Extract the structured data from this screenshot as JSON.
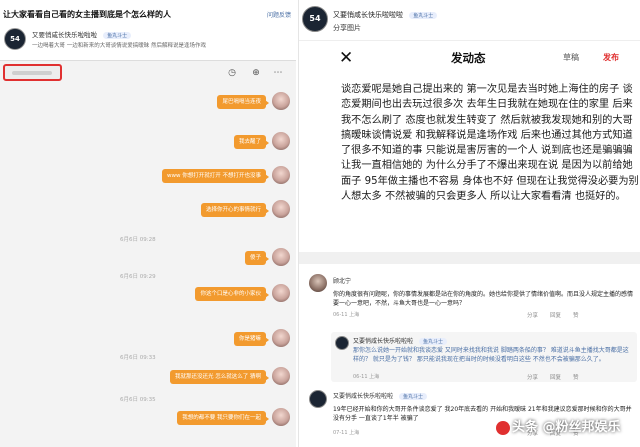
{
  "left": {
    "title": "让大家看看自己看的女主播到底是个怎么样的人",
    "report": "问题反馈",
    "author_name": "又要悄咸长快乐啦啦啦",
    "author_badge": "鱼丸斗士",
    "author_subtitle": "一边喝着大哥 一边和新来的大哥谈情说爱搞暧昧 然后解释说是逢场作戏",
    "messages": [
      {
        "text": "尾巴嗝嗝当连夜"
      },
      {
        "text": "我去醒了"
      },
      {
        "text": "www 你想打开就打开 不想打开也没事"
      },
      {
        "text": "选择你开心的事情就行"
      },
      {
        "text": "傻子"
      },
      {
        "text": "你这个口是心非的小家伙"
      },
      {
        "text": "你是猪嘛"
      },
      {
        "text": "我就那还没还光 怎么就这么了 猜啊"
      },
      {
        "text": "我想的都不要 我只要你们在一起"
      }
    ],
    "timestamps": [
      "6月6日 09:28",
      "6月6日 09:29",
      "6月6日 09:33",
      "6月6日 09:35"
    ]
  },
  "right": {
    "author_name": "又要悄咸长快乐啦啦啦",
    "author_badge": "鱼丸斗士",
    "share_label": "分享图片",
    "compose_title": "发动态",
    "close_icon": "✕",
    "draft_label": "草稿",
    "publish_label": "发布",
    "post_text": "谈恋爱呢是她自己提出来的 第一次见是去当时她上海住的房子 谈恋爱期间也出去玩过很多次 去年生日我就在她现在住的家里 后来我不怎么刷了 态度也就发生转变了 然后就被我发现她和别的大哥搞暧昧谈情说爱 和我解释说是逢场作戏 后来也通过其他方式知道了很多不知道的事 只能说是害厉害的一个人 说到底也还是骗骗骗让我一直相信她的 为什么分手了不爆出来现在说 是因为以前给她面子 95年做主播也不容易 身体也不好 但现在让我觉得没必要为别人想太多 不然被骗的只会更多人 所以让大家看看清 也挺好的。",
    "comments": [
      {
        "name": "顾北宁",
        "text": "你的角度很有问题呢，你的事情发展都是站在你的角度的。她也给你提供了情绪价值啊。而且没人规定主播的感情要一心一意吧，不然，斗鱼大哥也是一心一意吗？",
        "meta": "06-11  上海",
        "actions": [
          "分享",
          "回复",
          "赞"
        ]
      },
      {
        "name": "又要悄咸长快乐啦啦啦",
        "badge": "鱼丸斗士",
        "text": "那你怎么说她一开始就和我谈恋爱 又同时来找我和我说 脚踏两条船的事？ 难道说斗鱼主播找大哥都是这样的？ 就只是为了钱？ 那只能说我现在把当时的时候没看明白这些 不然也不会被骗那么久了。",
        "meta": "06-11  上海",
        "actions": [
          "分享",
          "回复",
          "赞"
        ]
      },
      {
        "name": "又要悄咸长快乐啦啦啦",
        "badge": "鱼丸斗士",
        "text": "19年已经开始和你的大哥开条件谈恋爱了 我20年底去看的 开始和我暧昧 21年和我建议恋爱那时候和你的大哥并没有分手 一直谈了1年半 被骗了",
        "meta": "07-11  上海",
        "actions": [
          "分享",
          "回复",
          "赞"
        ]
      }
    ]
  },
  "watermark": "头条 @粉丝邦娱乐",
  "colors": {
    "bubble": "#f29a2e",
    "publish": "#e03030",
    "highlight_box": "#e03030",
    "link": "#4a6fa5"
  }
}
